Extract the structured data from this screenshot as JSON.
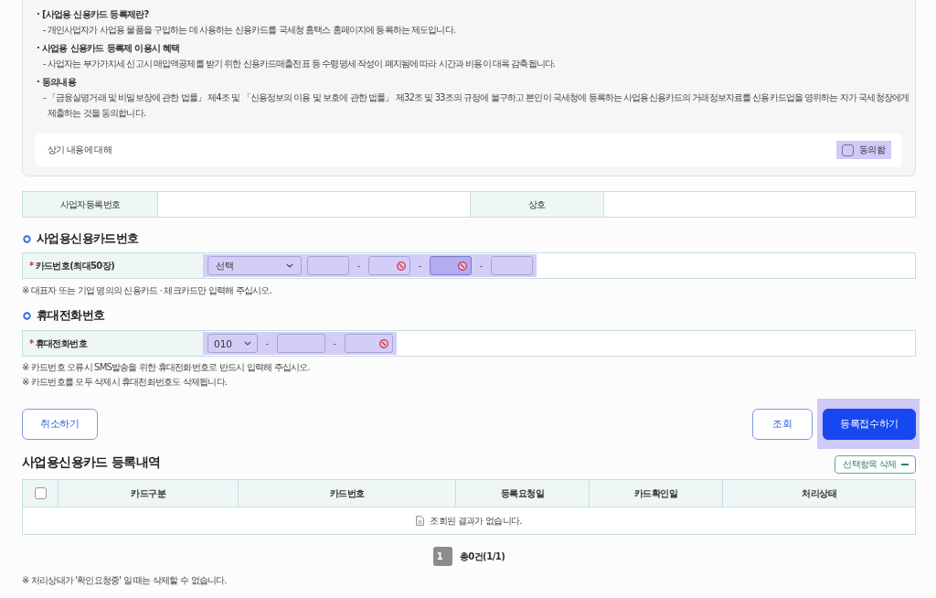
{
  "notice": {
    "sections": [
      {
        "heading": "· [사업용 신용카드 등록제란?",
        "text": "- 개인사업자가 사업용 물품을 구입하는 데 사용하는 신용카드를 국세청 홈택스 홈페이지에 등록하는 제도입니다."
      },
      {
        "heading": "· 사업용 신용카드 등록제 이용시 혜택",
        "text": "- 사업자는 부가가치세 신고시 매입액공제를 받기 위한 신용카드매출전표 등 수령명세 작성이 폐지됨에 따라 시간과 비용이 대폭 감축됩니다."
      },
      {
        "heading": "· 동의내용",
        "text": "- 「금융실명거래 및 비밀보장에 관한 법률」 제4조 및 「신용정보의 이용 및 보호에 관한 법률」 제32조 및 33조의 규정에 불구하고 본인이 국세청에 등록하는 사업용신용카드의 거래정보자료를 신용카드업을 영위하는 자가 국세청장에게 제출하는 것을 동의합니다."
      }
    ],
    "agree": {
      "prompt": "상기 내용에 대해",
      "label": "동의함",
      "checked": false,
      "highlighted": true
    }
  },
  "business_info": {
    "fields": [
      {
        "label": "사업자등록번호"
      },
      {
        "label": "상호"
      }
    ]
  },
  "card_number": {
    "title": "사업용신용카드번호",
    "required_mark": "*",
    "label": "카드번호(최대50장)",
    "highlighted": true,
    "parts": [
      {
        "kind": "select",
        "value": "선택"
      },
      {
        "kind": "input",
        "focused": false,
        "clearable": false
      },
      {
        "kind": "separator",
        "text": "-"
      },
      {
        "kind": "input",
        "focused": false,
        "clearable": true
      },
      {
        "kind": "separator",
        "text": "-"
      },
      {
        "kind": "input",
        "focused": true,
        "clearable": true
      },
      {
        "kind": "separator",
        "text": "-"
      },
      {
        "kind": "input",
        "focused": false,
        "clearable": false
      }
    ],
    "notes": [
      "※ 대표자 또는 기업 명의의 신용카드 · 체크카드만 입력해 주십시오."
    ]
  },
  "phone": {
    "title": "휴대전화번호",
    "required_mark": "*",
    "label": "휴대전화번호",
    "highlighted": true,
    "parts": [
      {
        "kind": "select",
        "value": "010"
      },
      {
        "kind": "separator",
        "text": "-"
      },
      {
        "kind": "input",
        "focused": false,
        "clearable": false
      },
      {
        "kind": "separator",
        "text": "-"
      },
      {
        "kind": "input",
        "focused": false,
        "clearable": true
      }
    ],
    "notes": [
      "※ 카드번호 오류시 SMS발송을 위한 휴대전화번호로 반드시 입력해 주십시오.",
      "※ 카드번호를 모두 삭제시 휴대전화번호도 삭제됩니다."
    ]
  },
  "actions": {
    "left": [
      {
        "label": "취소하기",
        "kind": "outline",
        "highlighted": false
      }
    ],
    "right": [
      {
        "label": "조회",
        "kind": "outline",
        "highlighted": false
      },
      {
        "label": "등록접수하기",
        "kind": "primary",
        "highlighted": true
      }
    ]
  },
  "registrations": {
    "title": "사업용신용카드 등록내역",
    "delete_button": "선택항목 삭제",
    "table": {
      "select_all_checked": false,
      "columns": [
        "카드구분",
        "카드번호",
        "등록요청일",
        "카드확인일",
        "처리상태"
      ],
      "empty_message": "조회된 결과가 없습니다."
    },
    "pagination": {
      "pages": [
        {
          "label": "1",
          "selected": true
        }
      ],
      "summary": "총0건(1/1)"
    },
    "note": "※ 처리상태가 '확인요청중' 일 때는 삭제할 수 없습니다."
  }
}
